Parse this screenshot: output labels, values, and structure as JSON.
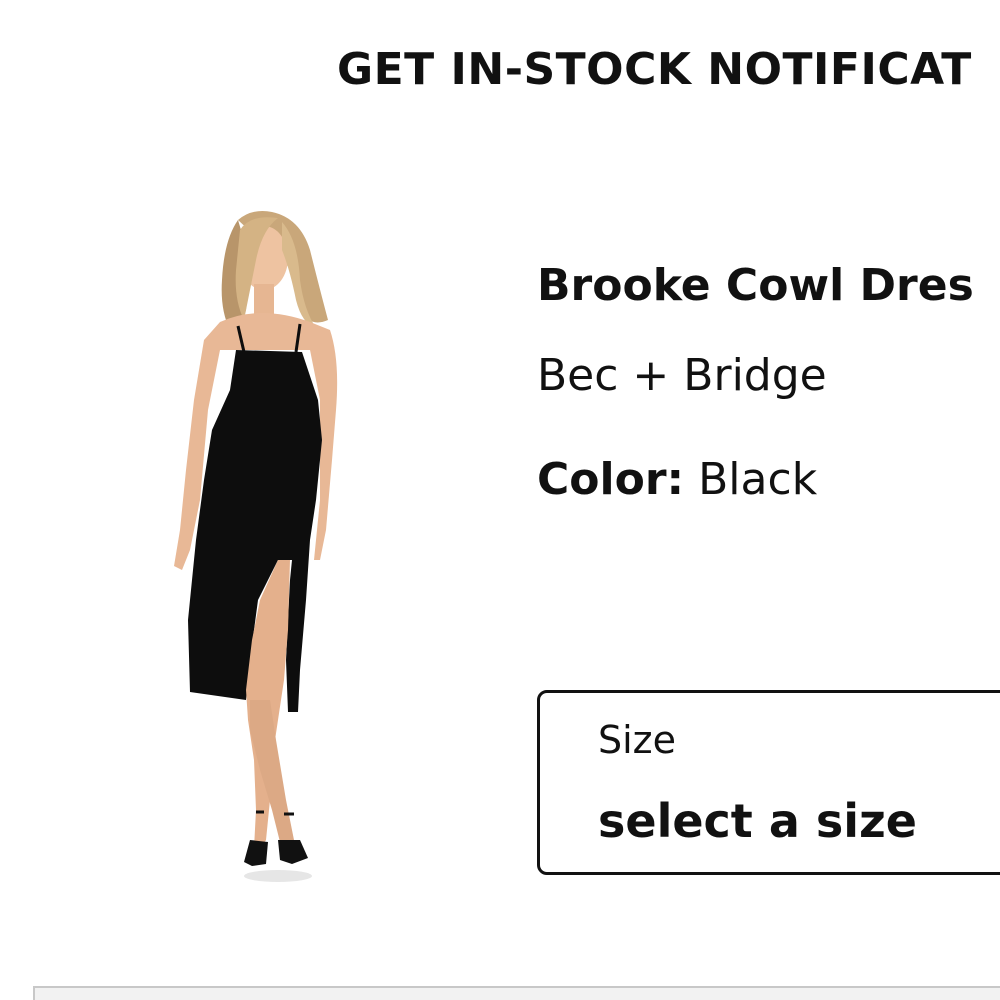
{
  "modal": {
    "title": "GET IN-STOCK NOTIFICAT"
  },
  "product": {
    "image_alt": "Model wearing black dress",
    "name": "Brooke Cowl Dres",
    "brand": "Bec + Bridge",
    "color_label": "Color:",
    "color_value": "Black"
  },
  "size_select": {
    "label": "Size",
    "value": "select a size"
  },
  "colors": {
    "text": "#111111",
    "background": "#ffffff",
    "dress": "#0d0d0d",
    "skin": "#e8b896",
    "hair": "#c9a77a"
  }
}
